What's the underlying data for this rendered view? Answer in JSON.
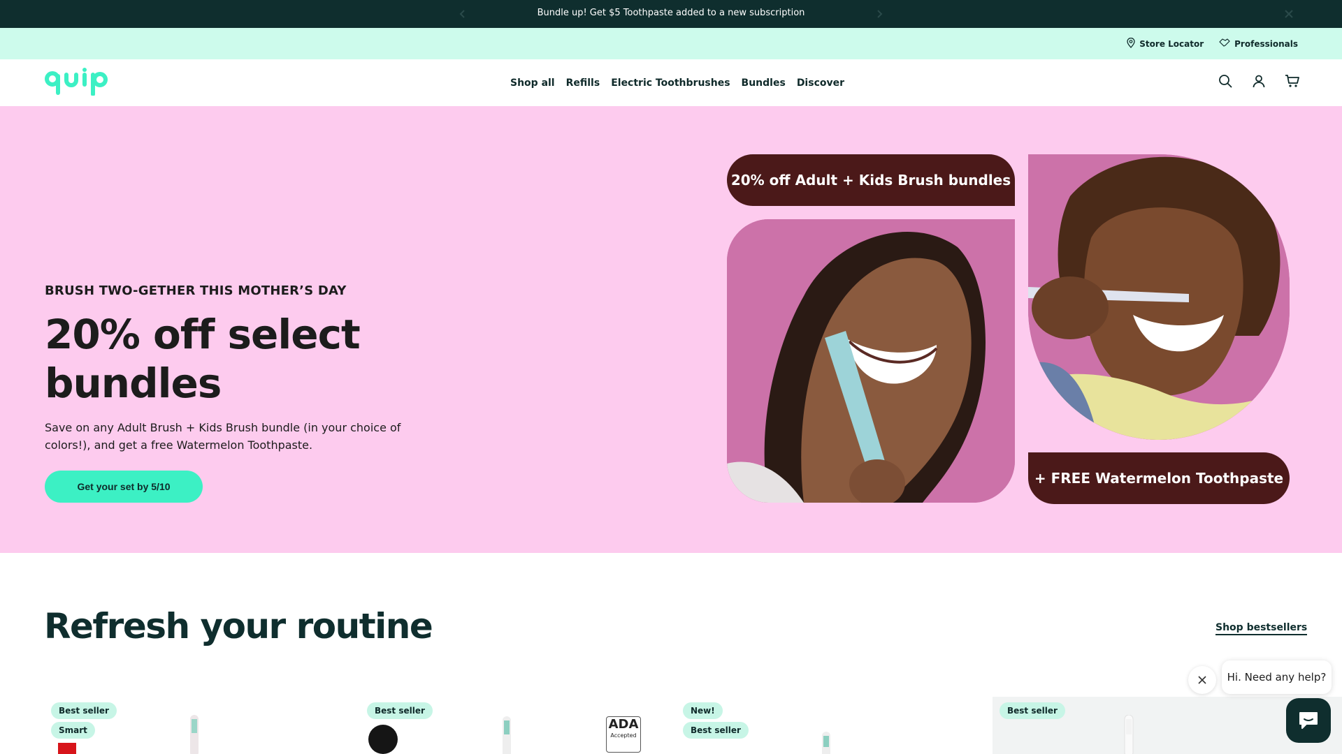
{
  "announcement": {
    "message": "Bundle up! Get $5 Toothpaste added to a new subscription"
  },
  "utility": {
    "store_locator": "Store Locator",
    "professionals": "Professionals"
  },
  "header": {
    "nav": [
      "Shop all",
      "Refills",
      "Electric Toothbrushes",
      "Bundles",
      "Discover"
    ]
  },
  "hero": {
    "eyebrow": "BRUSH TWO-GETHER THIS MOTHER’S DAY",
    "title": "20% off select bundles",
    "description": "Save on any Adult Brush + Kids Brush bundle (in your choice of colors!), and get a free Watermelon Toothpaste.",
    "cta": "Get your set by 5/10",
    "pill_top": "20% off Adult + Kids Brush bundles",
    "pill_bottom": "+ FREE Watermelon Toothpaste"
  },
  "section": {
    "title": "Refresh your routine",
    "link": "Shop bestsellers"
  },
  "products": [
    {
      "badges": [
        "Best seller",
        "Smart"
      ]
    },
    {
      "badges": [
        "Best seller"
      ],
      "seal": "ADA Accepted"
    },
    {
      "badges": [
        "New!",
        "Best seller"
      ]
    },
    {
      "badges": [
        "Best seller"
      ]
    }
  ],
  "chat": {
    "message": "Hi. Need any help?"
  },
  "colors": {
    "announce_bg": "#0f2e2e",
    "utility_bg": "#cdfbec",
    "hero_bg": "#fdcbee",
    "accent": "#3cf0c4",
    "pill_bg": "#4b1919"
  }
}
